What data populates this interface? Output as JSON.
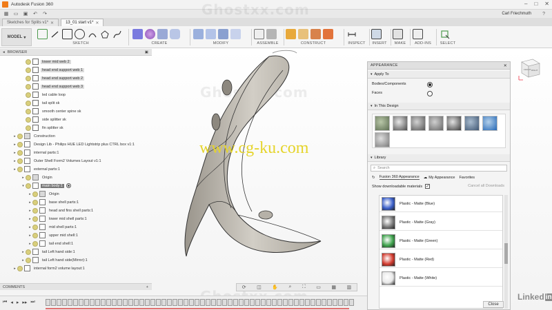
{
  "window": {
    "title": "Autodesk Fusion 360",
    "user": "Carl Friechmuth",
    "help": "?"
  },
  "tabs": [
    {
      "label": "Sketches for Splits v1*",
      "active": false
    },
    {
      "label": "13_01 start v1*",
      "active": true
    }
  ],
  "ribbon": {
    "model_label": "MODEL",
    "groups": [
      "SKETCH",
      "CREATE",
      "MODIFY",
      "ASSEMBLE",
      "CONSTRUCT",
      "INSPECT",
      "INSERT",
      "MAKE",
      "ADD-INS",
      "SELECT"
    ]
  },
  "browser": {
    "title": "BROWSER",
    "items": [
      {
        "label": "lower mid web 2",
        "depth": 0,
        "type": "sketch",
        "hl": true
      },
      {
        "label": "head end support web 1",
        "depth": 0,
        "type": "sketch",
        "hl": true
      },
      {
        "label": "head end support web 2",
        "depth": 0,
        "type": "sketch",
        "hl": true
      },
      {
        "label": "head end support web 3",
        "depth": 0,
        "type": "sketch",
        "hl": true
      },
      {
        "label": "led cable loop",
        "depth": 0,
        "type": "sketch",
        "hl": false
      },
      {
        "label": "tail split sk",
        "depth": 0,
        "type": "sketch",
        "hl": false
      },
      {
        "label": "smooth center spine sk",
        "depth": 0,
        "type": "sketch",
        "hl": false
      },
      {
        "label": "side splitter sk",
        "depth": 0,
        "type": "sketch",
        "hl": false
      },
      {
        "label": "fin splitter sk",
        "depth": 0,
        "type": "sketch",
        "hl": false
      },
      {
        "label": "Construction",
        "depth": -1,
        "type": "folder",
        "hl": false
      },
      {
        "label": "Design Lib - Philips HUE LED Lightstrip plus CTRL box v1:1",
        "depth": -1,
        "type": "comp",
        "hl": false
      },
      {
        "label": "internal parts:1",
        "depth": -1,
        "type": "comp",
        "hl": false
      },
      {
        "label": "Outer Shell Form2 Volumes Layout v1:1",
        "depth": -1,
        "type": "comp",
        "hl": false
      },
      {
        "label": "external parts:1",
        "depth": -1,
        "type": "comp",
        "hl": false
      },
      {
        "label": "Origin",
        "depth": 0,
        "type": "folder",
        "hl": false
      },
      {
        "label": "main body:1",
        "depth": 0,
        "type": "comp",
        "hl": false,
        "active": true
      },
      {
        "label": "Origin",
        "depth": 1,
        "type": "folder",
        "hl": false
      },
      {
        "label": "base shell parts:1",
        "depth": 1,
        "type": "comp",
        "hl": false
      },
      {
        "label": "head and fins shell parts:1",
        "depth": 1,
        "type": "comp",
        "hl": false
      },
      {
        "label": "lower mid shell parts:1",
        "depth": 1,
        "type": "comp",
        "hl": false
      },
      {
        "label": "mid shell parts:1",
        "depth": 1,
        "type": "comp",
        "hl": false
      },
      {
        "label": "upper mid shell:1",
        "depth": 1,
        "type": "comp",
        "hl": false
      },
      {
        "label": "tail end shell:1",
        "depth": 1,
        "type": "comp",
        "hl": false
      },
      {
        "label": "tail Left hand side:1",
        "depth": 0,
        "type": "comp",
        "hl": false
      },
      {
        "label": "tail Left hand side(Mirror):1",
        "depth": 0,
        "type": "comp",
        "hl": false
      },
      {
        "label": "internal form2 volume layout:1",
        "depth": -1,
        "type": "comp",
        "hl": false
      }
    ]
  },
  "comments": {
    "title": "COMMENTS",
    "add": "+"
  },
  "appearance": {
    "title": "APPEARANCE",
    "apply_to": {
      "heading": "Apply To",
      "options": [
        {
          "label": "Bodies/Components",
          "selected": true
        },
        {
          "label": "Faces",
          "selected": false
        }
      ]
    },
    "in_design": {
      "heading": "In This Design"
    },
    "library": {
      "heading": "Library",
      "search_placeholder": "Search",
      "tabs": [
        "Fusion 360 Appearance",
        "My Appearance",
        "Favorites"
      ],
      "show_downloadable": "Show downloadable materials",
      "cancel_downloads": "Cancel all Downloads",
      "materials": [
        {
          "label": "Plastic - Matte (Blue)",
          "color": "#3b5fc9"
        },
        {
          "label": "Plastic - Matte (Gray)",
          "color": "#7a7a7a"
        },
        {
          "label": "Plastic - Matte (Green)",
          "color": "#3fa34d"
        },
        {
          "label": "Plastic - Matte (Red)",
          "color": "#d33b2f"
        },
        {
          "label": "Plastic - Matte (White)",
          "color": "#e8e8e8"
        }
      ]
    },
    "close_label": "Close"
  },
  "viewcube": {
    "front": "FRONT",
    "right": "RIGHT"
  },
  "overlays": {
    "watermark": "Ghostxx.com",
    "cg": "www.cg-ku.com",
    "brand": "Linked",
    "brand_in": "in"
  }
}
